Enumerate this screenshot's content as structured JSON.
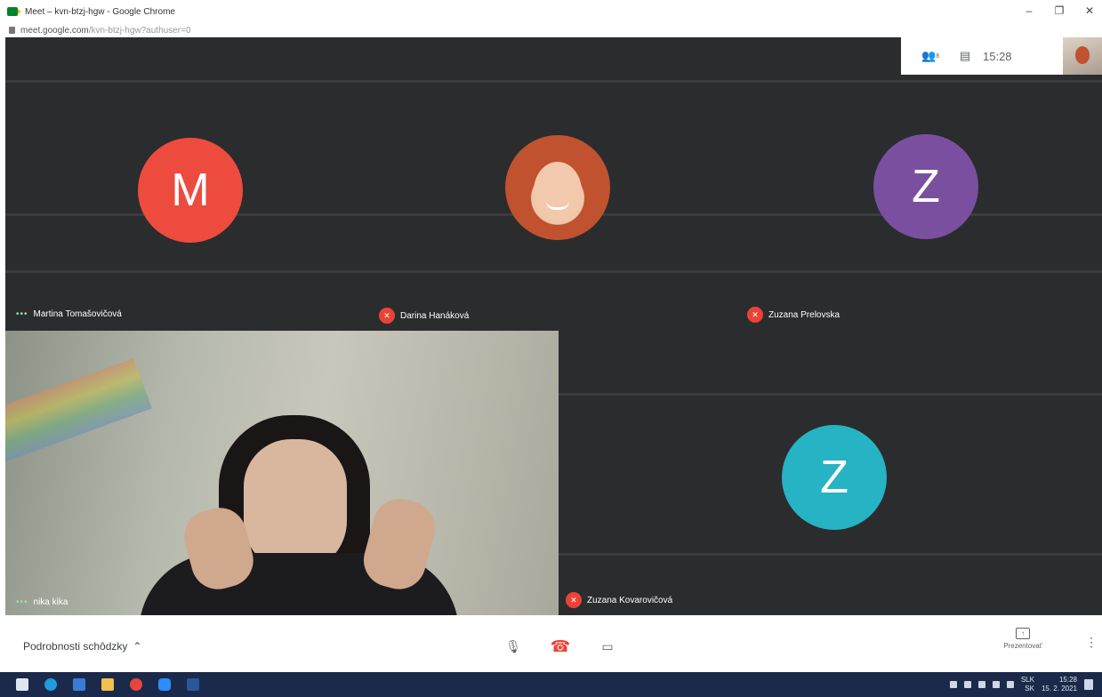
{
  "browser": {
    "window_title": "Meet – kvn-btzj-hgw - Google Chrome",
    "url_main": "meet.google.com",
    "url_path": "/kvn-btzj-hgw?authuser=0",
    "controls": [
      "–",
      "❐",
      "✕"
    ]
  },
  "topbar": {
    "people_icon": "people-icon",
    "people_count": "8",
    "chat_icon": "chat-icon",
    "time": "15:28"
  },
  "participants": [
    {
      "name": "Martina Tomašovičová",
      "initial": "M",
      "avatar_color": "#ee4b3f",
      "muted": false
    },
    {
      "name": "Darina Hanáková",
      "initial": "",
      "avatar_color": "#c0522f",
      "muted": true
    },
    {
      "name": "Zuzana Prelovska",
      "initial": "Z",
      "avatar_color": "#7b4fa0",
      "muted": true
    },
    {
      "name": "nika kika",
      "initial": "",
      "muted": false
    },
    {
      "name": "Zuzana Kovarovičová",
      "initial": "Z",
      "avatar_color": "#26b3c3",
      "muted": true
    }
  ],
  "bottombar": {
    "details_label": "Podrobnosti schôdzky",
    "details_icon": "chevron-up-icon",
    "mic_icon": "microphone-icon",
    "hangup_icon": "hang-up-icon",
    "camera_icon": "camera-icon",
    "present_label": "Prezentovať",
    "more_icon": "more-vert-icon"
  },
  "taskbar": {
    "tray_lang_1": "SLK",
    "tray_lang_2": "SK",
    "tray_time": "15:28",
    "tray_date": "15. 2. 2021"
  }
}
